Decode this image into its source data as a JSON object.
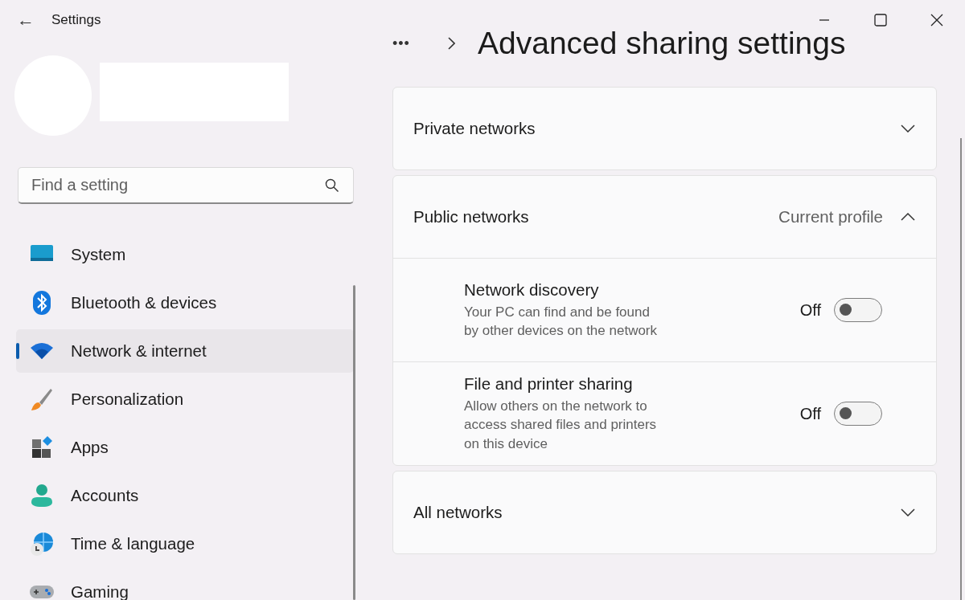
{
  "window": {
    "title": "Settings",
    "back": "←"
  },
  "search": {
    "placeholder": "Find a setting"
  },
  "nav": [
    {
      "label": "System",
      "selected": false
    },
    {
      "label": "Bluetooth & devices",
      "selected": false
    },
    {
      "label": "Network & internet",
      "selected": true
    },
    {
      "label": "Personalization",
      "selected": false
    },
    {
      "label": "Apps",
      "selected": false
    },
    {
      "label": "Accounts",
      "selected": false
    },
    {
      "label": "Time & language",
      "selected": false
    },
    {
      "label": "Gaming",
      "selected": false
    }
  ],
  "breadcrumb": {
    "ellipsis": "•••",
    "title": "Advanced sharing settings"
  },
  "sections": [
    {
      "title": "Private networks",
      "expanded": false
    },
    {
      "title": "Public networks",
      "tag": "Current profile",
      "expanded": true,
      "settings": [
        {
          "title": "Network discovery",
          "description": "Your PC can find and be found by other devices on the network",
          "state_label": "Off",
          "on": false
        },
        {
          "title": "File and printer sharing",
          "description": "Allow others on the network to access shared files and printers on this device",
          "state_label": "Off",
          "on": false
        }
      ]
    },
    {
      "title": "All networks",
      "expanded": false
    }
  ]
}
